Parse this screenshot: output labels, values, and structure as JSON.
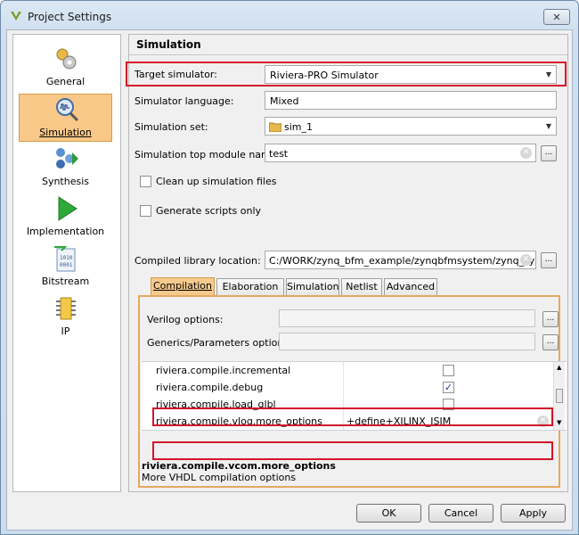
{
  "window": {
    "title": "Project Settings",
    "close_glyph": "✕"
  },
  "sidebar": {
    "items": [
      {
        "label": "General",
        "icon": "gears-icon"
      },
      {
        "label": "Simulation",
        "icon": "magnifier-waveform-icon",
        "selected": true
      },
      {
        "label": "Synthesis",
        "icon": "synthesis-icon"
      },
      {
        "label": "Implementation",
        "icon": "play-arrow-icon"
      },
      {
        "label": "Bitstream",
        "icon": "bitstream-file-icon"
      },
      {
        "label": "IP",
        "icon": "chip-icon"
      }
    ]
  },
  "panel": {
    "title": "Simulation",
    "target_simulator": {
      "label": "Target simulator:",
      "value": "Riviera-PRO Simulator"
    },
    "simulator_language": {
      "label": "Simulator language:",
      "value": "Mixed"
    },
    "simulation_set": {
      "label": "Simulation set:",
      "value": "sim_1"
    },
    "top_module": {
      "label": "Simulation top module name:",
      "value": "test"
    },
    "cleanup": {
      "label": "Clean up simulation files",
      "checked": false
    },
    "generate_scripts": {
      "label": "Generate scripts only",
      "checked": false
    },
    "compiled_lib": {
      "label": "Compiled library location:",
      "value": "C:/WORK/zynq_bfm_example/zynqbfmsystem/zynq_system"
    },
    "dots": "..."
  },
  "tabs": [
    {
      "label": "Compilation",
      "active": true
    },
    {
      "label": "Elaboration"
    },
    {
      "label": "Simulation"
    },
    {
      "label": "Netlist"
    },
    {
      "label": "Advanced"
    }
  ],
  "compilation": {
    "verilog_options": {
      "label": "Verilog options:",
      "value": ""
    },
    "generics_options": {
      "label": "Generics/Parameters options:",
      "value": ""
    },
    "rows": [
      {
        "key": "riviera.compile.incremental",
        "type": "checkbox",
        "checked": false
      },
      {
        "key": "riviera.compile.debug",
        "type": "checkbox",
        "checked": true
      },
      {
        "key": "riviera.compile.load_glbl",
        "type": "checkbox",
        "checked": false
      },
      {
        "key": "riviera.compile.vlog.more_options",
        "type": "text",
        "value": "+define+XILINX_ISIM"
      }
    ],
    "description": {
      "title": "riviera.compile.vcom.more_options",
      "text": "More VHDL compilation options"
    }
  },
  "buttons": {
    "ok": "OK",
    "cancel": "Cancel",
    "apply": "Apply"
  },
  "colors": {
    "highlight_red": "#d2142a",
    "selection_orange": "#f8c888"
  }
}
